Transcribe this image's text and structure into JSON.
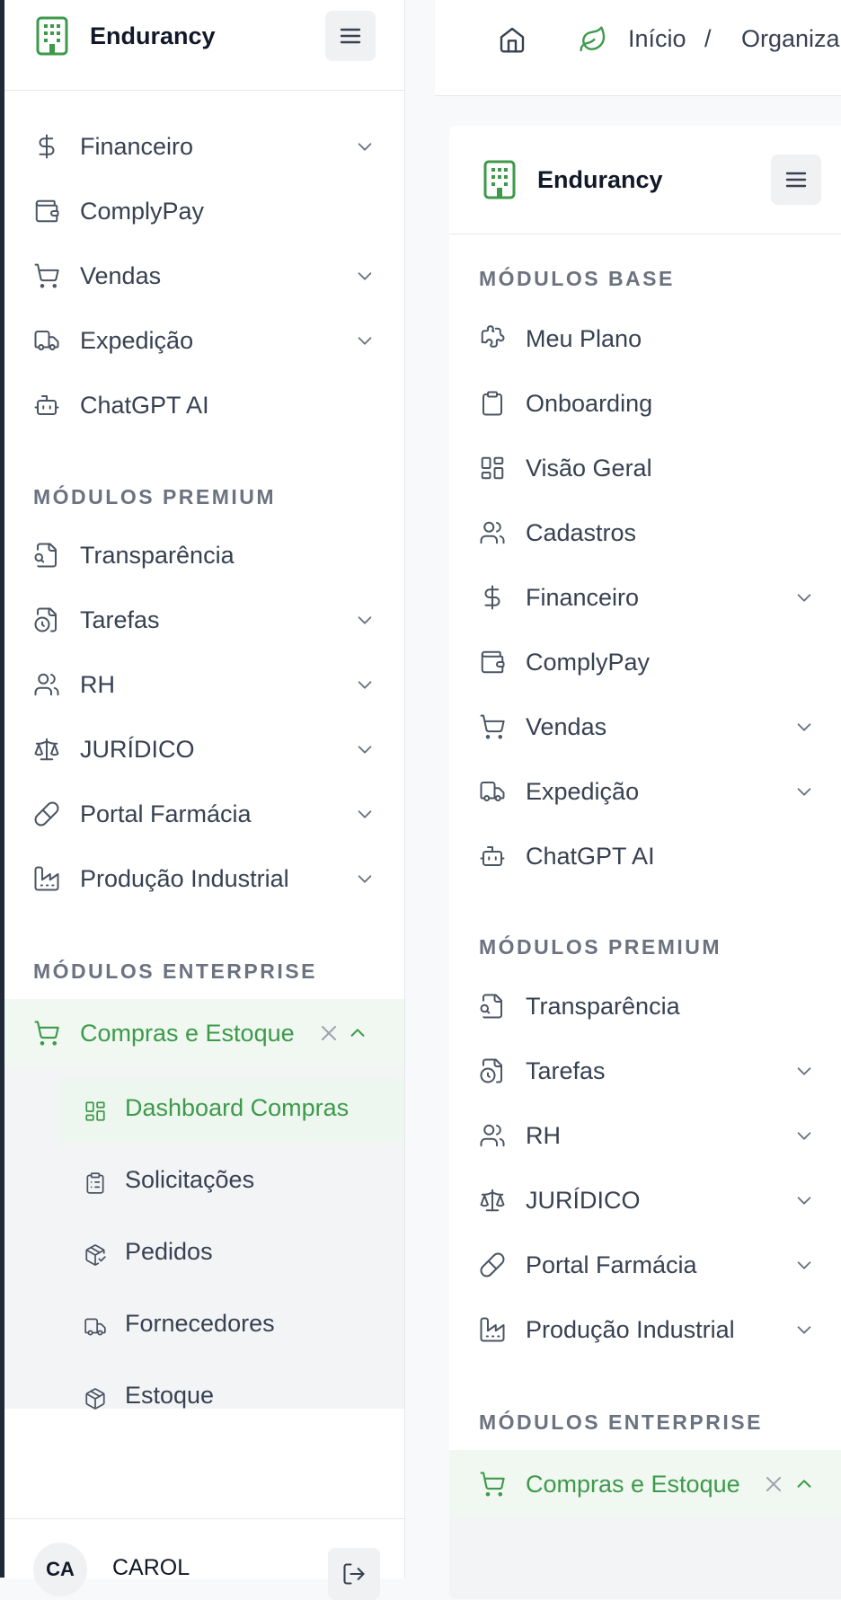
{
  "left_sidebar": {
    "brand": "Endurancy",
    "menu_items_top": [
      {
        "label": "Financeiro",
        "icon": "dollar-icon",
        "expandable": true
      },
      {
        "label": "ComplyPay",
        "icon": "wallet-icon",
        "expandable": false
      },
      {
        "label": "Vendas",
        "icon": "cart-icon",
        "expandable": true
      },
      {
        "label": "Expedição",
        "icon": "truck-icon",
        "expandable": true
      },
      {
        "label": "ChatGPT AI",
        "icon": "bot-icon",
        "expandable": false
      }
    ],
    "premium_title": "MÓDULOS PREMIUM",
    "premium_items": [
      {
        "label": "Transparência",
        "icon": "file-search-icon",
        "expandable": false
      },
      {
        "label": "Tarefas",
        "icon": "file-clock-icon",
        "expandable": true
      },
      {
        "label": "RH",
        "icon": "users-icon",
        "expandable": true
      },
      {
        "label": "JURÍDICO",
        "icon": "scale-icon",
        "expandable": true
      },
      {
        "label": "Portal Farmácia",
        "icon": "pill-icon",
        "expandable": true
      },
      {
        "label": "Produção Industrial",
        "icon": "factory-icon",
        "expandable": true
      }
    ],
    "enterprise_title": "MÓDULOS ENTERPRISE",
    "active_item": {
      "label": "Compras e Estoque",
      "icon": "cart-icon"
    },
    "sub_items": [
      {
        "label": "Dashboard Compras",
        "icon": "layout-dashboard-icon",
        "active": true
      },
      {
        "label": "Solicitações",
        "icon": "clipboard-list-icon",
        "active": false
      },
      {
        "label": "Pedidos",
        "icon": "package-check-icon",
        "active": false
      },
      {
        "label": "Fornecedores",
        "icon": "truck-icon",
        "active": false
      },
      {
        "label": "Estoque",
        "icon": "package-icon",
        "active": false
      }
    ],
    "user": {
      "initials": "CA",
      "name": "CAROL"
    }
  },
  "breadcrumb": {
    "home": "Início",
    "separator": "/",
    "current": "Organiza"
  },
  "panel": {
    "brand": "Endurancy",
    "base_title": "MÓDULOS BASE",
    "base_items": [
      {
        "label": "Meu Plano",
        "icon": "puzzle-icon",
        "expandable": false
      },
      {
        "label": "Onboarding",
        "icon": "clipboard-icon",
        "expandable": false
      },
      {
        "label": "Visão Geral",
        "icon": "layout-dashboard-icon",
        "expandable": false
      },
      {
        "label": "Cadastros",
        "icon": "users-icon",
        "expandable": false
      },
      {
        "label": "Financeiro",
        "icon": "dollar-icon",
        "expandable": true
      },
      {
        "label": "ComplyPay",
        "icon": "wallet-icon",
        "expandable": false
      },
      {
        "label": "Vendas",
        "icon": "cart-icon",
        "expandable": true
      },
      {
        "label": "Expedição",
        "icon": "truck-icon",
        "expandable": true
      },
      {
        "label": "ChatGPT AI",
        "icon": "bot-icon",
        "expandable": false
      }
    ],
    "premium_title": "MÓDULOS PREMIUM",
    "premium_items": [
      {
        "label": "Transparência",
        "icon": "file-search-icon",
        "expandable": false
      },
      {
        "label": "Tarefas",
        "icon": "file-clock-icon",
        "expandable": true
      },
      {
        "label": "RH",
        "icon": "users-icon",
        "expandable": true
      },
      {
        "label": "JURÍDICO",
        "icon": "scale-icon",
        "expandable": true
      },
      {
        "label": "Portal Farmácia",
        "icon": "pill-icon",
        "expandable": true
      },
      {
        "label": "Produção Industrial",
        "icon": "factory-icon",
        "expandable": true
      }
    ],
    "enterprise_title": "MÓDULOS ENTERPRISE",
    "active_item": {
      "label": "Compras e Estoque",
      "icon": "cart-icon"
    }
  },
  "colors": {
    "accent": "#3d9a4a",
    "active_bg": "#f0f8f1",
    "text": "#374151",
    "muted": "#6b7280"
  }
}
